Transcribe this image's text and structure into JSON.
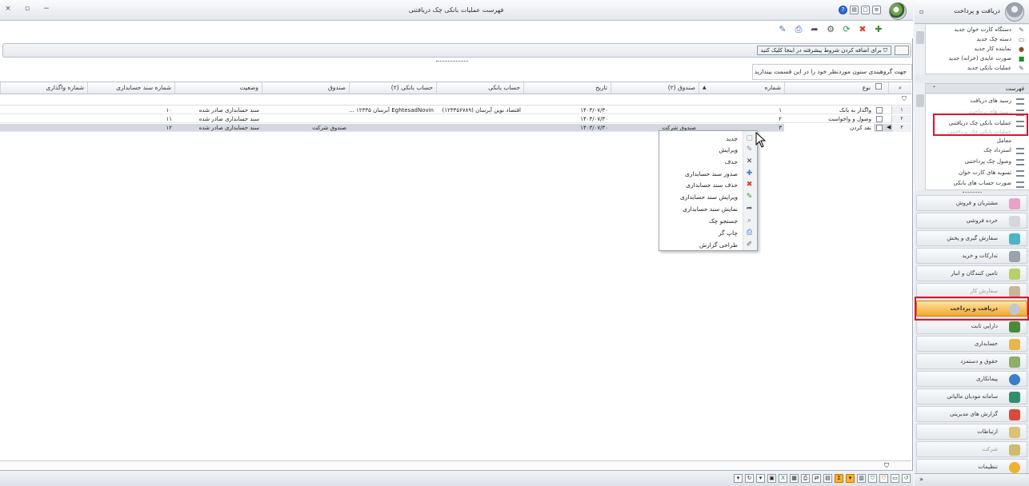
{
  "window": {
    "title": "فهرست عملیات بانکی چک دریافتنی",
    "controls": {
      "close": "×",
      "restore": "▫",
      "minimize": "−"
    }
  },
  "filter_bar": {
    "button_label": "برای اضافه کردن شروط پیشرفته در اینجا کلیک کنید"
  },
  "group_hint": "جهت گروهبندی ستون موردنظر خود را در این قسمت بیندازید",
  "grid": {
    "columns": [
      "نوع",
      "شماره",
      "صندوق (۲)",
      "تاریخ",
      "حساب بانکی",
      "حساب بانکی (۲)",
      "صندوق",
      "وضعیت",
      "شماره سند حسابداری",
      "شماره واگذاری"
    ],
    "rows": [
      {
        "index": "۱",
        "type": "واگذار به بانک",
        "number": "۱",
        "fund2": "",
        "date": "۱۴۰۳/۰۷/۳۰",
        "bank_account": "اقتصاد نوین آبرسان (۱۲۳۳۵۶۷۸۹)",
        "bank_account2": "EghtesadNovin آبرسان ۱۲۳۳۵ ...",
        "fund": "",
        "status": "سند حسابداری صادر شده",
        "doc_number": "۱۰",
        "assign_number": ""
      },
      {
        "index": "۲",
        "type": "وصول و واخواست",
        "number": "۲",
        "fund2": "",
        "date": "۱۴۰۳/۰۷/۳۰",
        "bank_account": "",
        "bank_account2": "",
        "fund": "",
        "status": "سند حسابداری صادر شده",
        "doc_number": "۱۱",
        "assign_number": ""
      },
      {
        "index": "۳",
        "type": "نقد کردن",
        "number": "۳",
        "fund2": "صندوق شرکت",
        "date": "۱۴۰۳/۰۷/۳۰",
        "bank_account": "",
        "bank_account2": "",
        "fund": "صندوق شرکت",
        "status": "سند حسابداری صادر شده",
        "doc_number": "۱۲",
        "assign_number": ""
      }
    ]
  },
  "context_menu": {
    "items": [
      {
        "label": "جدید",
        "icon": "new-doc-icon"
      },
      {
        "label": "ویرایش",
        "icon": "edit-icon"
      },
      {
        "label": "حذف",
        "icon": "delete-icon"
      },
      {
        "label": "صدور سند حسابداری",
        "icon": "issue-doc-icon"
      },
      {
        "label": "حذف سند حسابداری",
        "icon": "delete-doc-icon"
      },
      {
        "label": "ویرایش سند حسابداری",
        "icon": "edit-doc-icon"
      },
      {
        "label": "نمایش سند حسابداری",
        "icon": "show-doc-icon"
      },
      {
        "label": "جستجو چک",
        "icon": "search-check-icon"
      },
      {
        "label": "چاپ گر",
        "icon": "printer-icon"
      },
      {
        "label": "طراحی گزارش",
        "icon": "design-icon"
      }
    ]
  },
  "sidebar": {
    "header": "دریافت و پرداخت",
    "quick_items": [
      "دستگاه کارت خوان جدید",
      "دسته چک جدید",
      "نماینده کار جدید",
      "صورت عایدی (خزانه) جدید",
      "عملیات بانکی جدید"
    ],
    "list_title": "فهرست",
    "list_items": [
      "رسید های دریافت",
      "رسید های پرداخت",
      "عملیات بانکی چک دریافتنی",
      "عملیات بانکی چک پرداختنی",
      "معامل",
      "استرداد چک",
      "وصول چک پرداختنی",
      "تسویه های کارت خوان",
      "صورت حساب های بانکی"
    ],
    "modules": [
      "مشتریان و فروش",
      "خرده فروشی",
      "سفارش گیری و پخش",
      "تدارکات و خرید",
      "تامین کنندگان و انبار",
      "سفارش کار",
      "دریافت و پرداخت",
      "دارایی ثابت",
      "حسابداری",
      "حقوق و دستمزد",
      "پیمانکاری",
      "سامانه مودیان مالیاتی",
      "گزارش های مدیریتی",
      "ارتباطات",
      "شرکت",
      "تنظیمات"
    ],
    "active_module": "دریافت و پرداخت"
  }
}
